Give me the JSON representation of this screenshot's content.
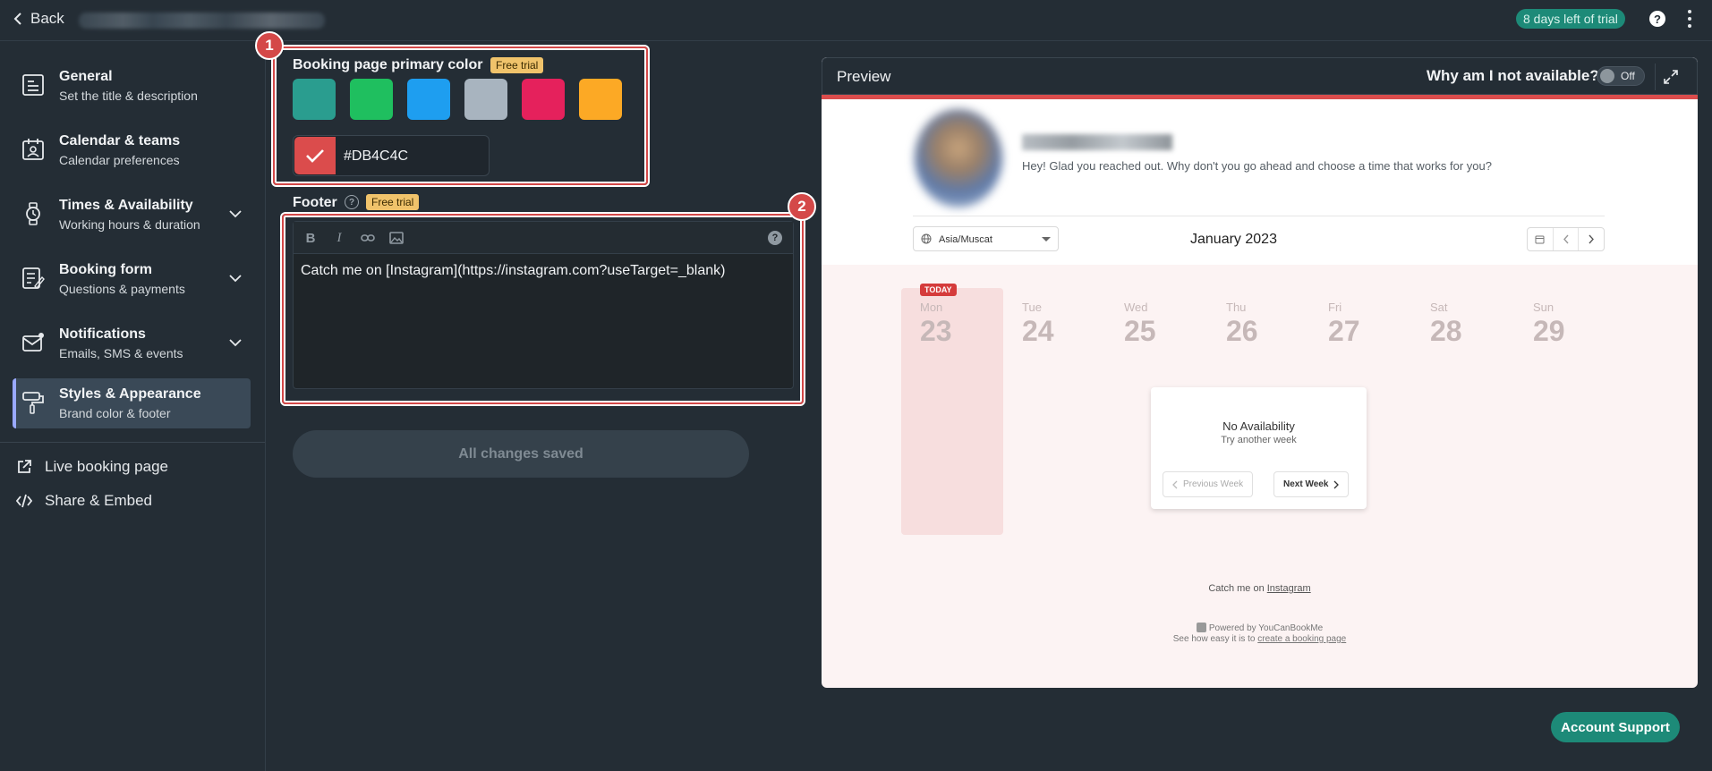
{
  "topbar": {
    "back_label": "Back",
    "trial_badge": "8 days left of trial",
    "help": "?"
  },
  "sidebar": {
    "items": [
      {
        "title": "General",
        "subtitle": "Set the title & description"
      },
      {
        "title": "Calendar & teams",
        "subtitle": "Calendar preferences"
      },
      {
        "title": "Times & Availability",
        "subtitle": "Working hours & duration"
      },
      {
        "title": "Booking form",
        "subtitle": "Questions & payments"
      },
      {
        "title": "Notifications",
        "subtitle": "Emails, SMS & events"
      },
      {
        "title": "Styles & Appearance",
        "subtitle": "Brand color & footer"
      }
    ],
    "links": [
      {
        "label": "Live booking page"
      },
      {
        "label": "Share & Embed"
      }
    ]
  },
  "color_section": {
    "label": "Booking page primary color",
    "free_trial": "Free trial",
    "swatches": [
      "#2a9d8f",
      "#1fbf5f",
      "#1e9ef0",
      "#a8b4bf",
      "#e5215c",
      "#fca925"
    ],
    "selected_color": "#DB4C4C"
  },
  "footer_section": {
    "label": "Footer",
    "free_trial": "Free trial",
    "content": "Catch me on [Instagram](https://instagram.com?useTarget=_blank)"
  },
  "annotations": [
    "1",
    "2"
  ],
  "save_button": "All changes saved",
  "preview": {
    "title": "Preview",
    "why_label": "Why am I not available?",
    "toggle_label": "Off",
    "intro": "Hey! Glad you reached out. Why don't you go ahead and choose a time that works for you?",
    "timezone": "Asia/Muscat",
    "month": "January 2023",
    "today_badge": "TODAY",
    "days": [
      {
        "name": "Mon",
        "date": "23"
      },
      {
        "name": "Tue",
        "date": "24"
      },
      {
        "name": "Wed",
        "date": "25"
      },
      {
        "name": "Thu",
        "date": "26"
      },
      {
        "name": "Fri",
        "date": "27"
      },
      {
        "name": "Sat",
        "date": "28"
      },
      {
        "name": "Sun",
        "date": "29"
      }
    ],
    "no_availability": "No Availability",
    "try_another": "Try another week",
    "prev_week": "Previous Week",
    "next_week": "Next Week",
    "footer_prefix": "Catch me on ",
    "footer_link": "Instagram",
    "powered": "Powered by YouCanBookMe",
    "see_how_prefix": "See how easy it is to ",
    "see_how_link": "create a booking page"
  },
  "support_button": "Account Support"
}
